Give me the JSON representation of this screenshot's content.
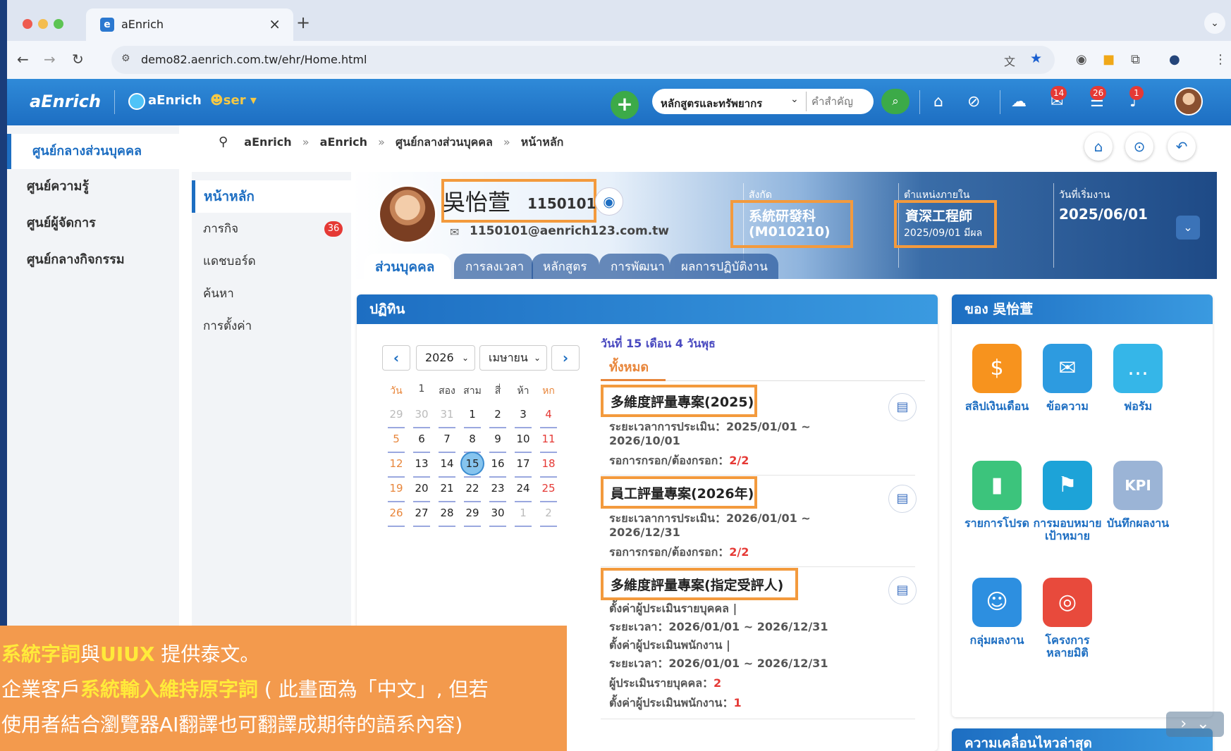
{
  "browser": {
    "tab_title": "aEnrich",
    "favicon_letter": "e",
    "new_tab": "+",
    "url": "demo82.aenrich.com.tw/ehr/Home.html"
  },
  "header": {
    "logo": "aEnrich",
    "company": "aEnrich",
    "user_label": "ser",
    "add_label": "+",
    "search_category": "หลักสูตรและทรัพยากร",
    "search_placeholder": "คำสำคัญ",
    "badges": {
      "msg": "14",
      "task": "26",
      "bell": "1"
    }
  },
  "left_nav": {
    "items": [
      {
        "label": "ศูนย์กลางส่วนบุคคล",
        "active": true
      },
      {
        "label": "ศูนย์ความรู้"
      },
      {
        "label": "ศูนย์ผู้จัดการ"
      },
      {
        "label": "ศูนย์กลางกิจกรรม"
      }
    ]
  },
  "breadcrumb": {
    "items": [
      "aEnrich",
      "aEnrich",
      "ศูนย์กลางส่วนบุคคล",
      "หน้าหลัก"
    ],
    "sep": "»"
  },
  "sub_nav": {
    "items": [
      {
        "label": "หน้าหลัก",
        "active": true
      },
      {
        "label": "ภารกิจ",
        "badge": "36"
      },
      {
        "label": "แดชบอร์ด"
      },
      {
        "label": "ค้นหา"
      },
      {
        "label": "การตั้งค่า"
      }
    ]
  },
  "profile": {
    "name": "吳怡萱",
    "id": "1150101",
    "email": "1150101@aenrich123.com.tw",
    "dept_label": "สังกัด",
    "dept_value": "系統研發科",
    "dept_code": "(M010210)",
    "pos_label": "ตำแหน่งภายใน",
    "pos_value": "資深工程師",
    "pos_sub": "2025/09/01 มีผล",
    "start_label": "วันที่เริ่มงาน",
    "start_value": "2025/06/01",
    "tabs": [
      "ส่วนบุคคล",
      "การลงเวลา",
      "หลักสูตร",
      "การพัฒนา",
      "ผลการปฏิบัติงาน"
    ]
  },
  "calendar": {
    "title": "ปฏิทิน",
    "year": "2026",
    "month": "เมษายน",
    "dow": [
      "วัน",
      "1",
      "สอง",
      "สาม",
      "สี่",
      "ห้า",
      "หก"
    ],
    "weeks": [
      [
        "29",
        "30",
        "31",
        "1",
        "2",
        "3",
        "4"
      ],
      [
        "5",
        "6",
        "7",
        "8",
        "9",
        "10",
        "11"
      ],
      [
        "12",
        "13",
        "14",
        "15",
        "16",
        "17",
        "18"
      ],
      [
        "19",
        "20",
        "21",
        "22",
        "23",
        "24",
        "25"
      ],
      [
        "26",
        "27",
        "28",
        "29",
        "30",
        "1",
        "2"
      ]
    ],
    "today": "15"
  },
  "tasks": {
    "date": "วันที่ 15 เดือน 4  วันพุธ",
    "filter": "ทั้งหมด",
    "items": [
      {
        "title": "多維度評量專案(2025)",
        "l1": "ระยะเวลาการประเมิน：2025/01/01 ~",
        "l2": "2026/10/01",
        "l3": "รอการกรอก/ต้องกรอก：",
        "l3v": "2/2"
      },
      {
        "title": "員工評量專案(2026年)",
        "l1": "ระยะเวลาการประเมิน：2026/01/01 ~",
        "l2": "2026/12/31",
        "l3": "รอการกรอก/ต้องกรอก：",
        "l3v": "2/2"
      },
      {
        "title": "多維度評量專案(指定受評人)",
        "l1": "ตั้งค่าผู้ประเมินรายบุคคล |",
        "l2": "ระยะเวลา：2026/01/01 ~ 2026/12/31",
        "l3": "ตั้งค่าผู้ประเมินพนักงาน |",
        "l4": "ระยะเวลา：2026/01/01 ~ 2026/12/31",
        "l5": "ผู้ประเมินรายบุคคล：",
        "l5v": "2",
        "l6": "ตั้งค่าผู้ประเมินพนักงาน：",
        "l6v": "1"
      }
    ]
  },
  "quick": {
    "title": "ของ 吳怡萱",
    "items": [
      {
        "label": "สลิปเงินเดือน",
        "icon": "payslip-icon",
        "color": "#f7931e"
      },
      {
        "label": "ข้อความ",
        "icon": "envelope-icon",
        "color": "#2d9be0"
      },
      {
        "label": "ฟอรัม",
        "icon": "chat-icon",
        "color": "#35b6e8"
      },
      {
        "label": "รายการโปรด",
        "icon": "bookmark-icon",
        "color": "#3cc47c"
      },
      {
        "label": "การมอบหมายเป้าหมาย",
        "icon": "goal-icon",
        "color": "#1da3d8"
      },
      {
        "label": "บันทึกผลงาน",
        "icon": "kpi-icon",
        "color": "#9bb4d6"
      },
      {
        "label": "กลุ่มผลงาน",
        "icon": "group-icon",
        "color": "#2d8fe0"
      },
      {
        "label": "โครงการหลายมิติ",
        "icon": "project-icon",
        "color": "#e84a3c"
      }
    ]
  },
  "recent": {
    "title": "ความเคลื่อนไหวล่าสุด"
  },
  "note": {
    "line1a": "系統字詞",
    "line1b": "與",
    "line1c": "UIUX",
    "line1d": " 提供泰文。",
    "line2a": "企業客戶",
    "line2b": "系統輸入維持原字詞",
    "line2c": " ( 此畫面為「中文」, 但若",
    "line3": "使用者結合瀏覽器AI翻譯也可翻譯成期待的語系內容)"
  }
}
